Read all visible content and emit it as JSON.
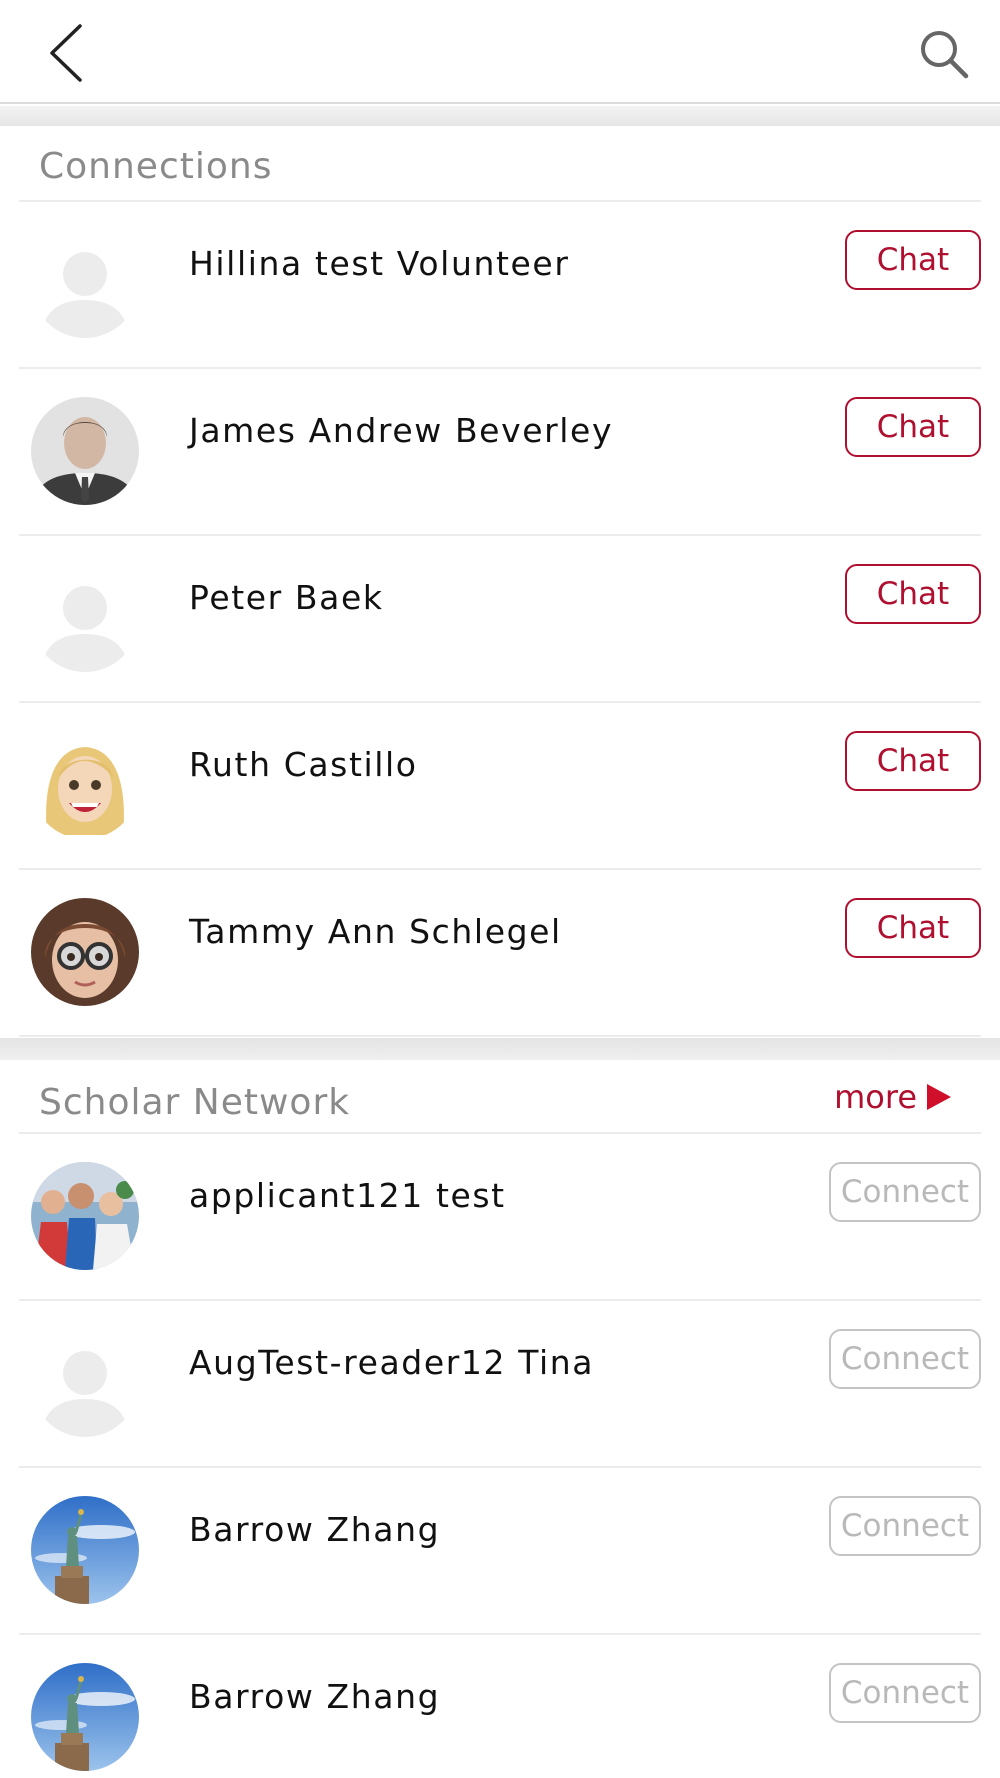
{
  "header": {
    "back_icon": "chevron-left-icon",
    "search_icon": "search-icon"
  },
  "connections": {
    "title": "Connections",
    "items": [
      {
        "name": "Hillina test Volunteer",
        "action": "Chat",
        "avatar": "placeholder"
      },
      {
        "name": "James Andrew Beverley",
        "action": "Chat",
        "avatar": "photo"
      },
      {
        "name": "Peter Baek",
        "action": "Chat",
        "avatar": "placeholder"
      },
      {
        "name": "Ruth Castillo",
        "action": "Chat",
        "avatar": "cartoon-blonde"
      },
      {
        "name": "Tammy Ann Schlegel",
        "action": "Chat",
        "avatar": "cartoon-glasses"
      }
    ]
  },
  "scholar_network": {
    "title": "Scholar Network",
    "more_label": "more",
    "items": [
      {
        "name": "applicant121 test",
        "action": "Connect",
        "avatar": "group-photo"
      },
      {
        "name": "AugTest-reader12 Tina",
        "action": "Connect",
        "avatar": "placeholder"
      },
      {
        "name": "Barrow Zhang",
        "action": "Connect",
        "avatar": "statue-of-liberty"
      },
      {
        "name": "Barrow Zhang",
        "action": "Connect",
        "avatar": "statue-of-liberty"
      }
    ]
  },
  "colors": {
    "accent": "#b0102f",
    "arrow": "#d0102a",
    "section_title": "#8a8a8a",
    "connect_gray": "#b9b9b9",
    "divider": "#ececec"
  }
}
